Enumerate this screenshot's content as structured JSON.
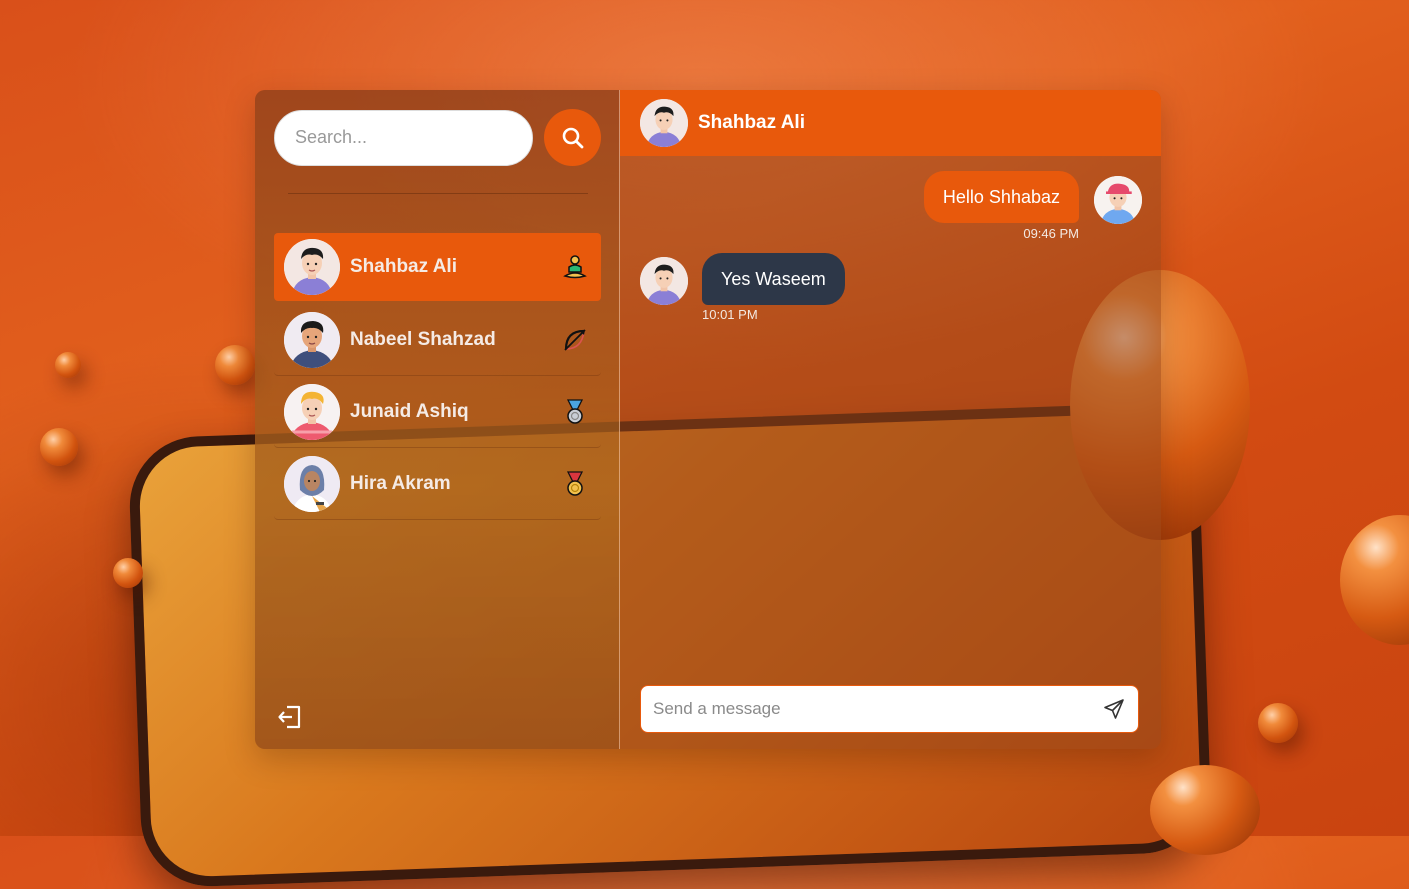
{
  "sidebar": {
    "search_placeholder": "Search...",
    "contacts": [
      {
        "name": "Shahbaz Ali",
        "badge": "meditation-icon",
        "active": true
      },
      {
        "name": "Nabeel Shahzad",
        "badge": "bow-arrow-icon",
        "active": false
      },
      {
        "name": "Junaid Ashiq",
        "badge": "silver-medal-icon",
        "active": false
      },
      {
        "name": "Hira Akram",
        "badge": "gold-medal-icon",
        "active": false
      }
    ]
  },
  "chat": {
    "title": "Shahbaz Ali",
    "messages": [
      {
        "direction": "outgoing",
        "text": "Hello Shhabaz",
        "time": "09:46 PM"
      },
      {
        "direction": "incoming",
        "text": "Yes Waseem",
        "time": "10:01 PM"
      }
    ],
    "composer_placeholder": "Send a message"
  },
  "colors": {
    "accent": "#e8590c",
    "incoming_bubble": "#2d3748"
  }
}
